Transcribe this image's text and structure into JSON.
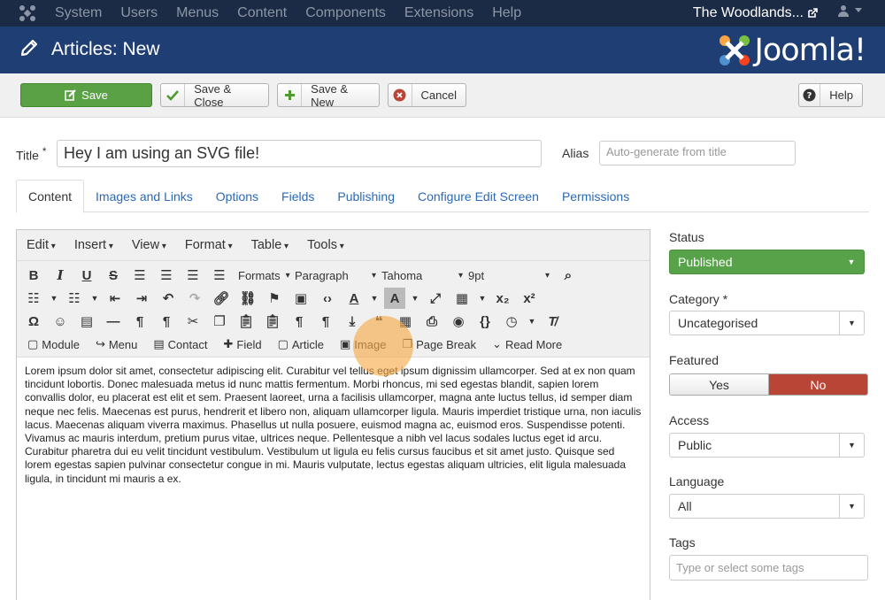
{
  "topbar": {
    "menu": [
      "System",
      "Users",
      "Menus",
      "Content",
      "Components",
      "Extensions",
      "Help"
    ],
    "site_name": "The Woodlands...",
    "icons": [
      "joomla-logo-icon",
      "external-link-icon",
      "user-icon",
      "caret-down-icon"
    ]
  },
  "header": {
    "title": "Articles: New",
    "brand": "Joomla!"
  },
  "toolbar": {
    "save": "Save",
    "save_close": "Save & Close",
    "save_new": "Save & New",
    "cancel": "Cancel",
    "help": "Help"
  },
  "form": {
    "title_label": "Title",
    "title_required": "*",
    "title_value": "Hey I am using an SVG file!",
    "alias_label": "Alias",
    "alias_placeholder": "Auto-generate from title"
  },
  "tabs": [
    "Content",
    "Images and Links",
    "Options",
    "Fields",
    "Publishing",
    "Configure Edit Screen",
    "Permissions"
  ],
  "editor": {
    "menus": [
      "Edit",
      "Insert",
      "View",
      "Format",
      "Table",
      "Tools"
    ],
    "formats": "Formats",
    "block": "Paragraph",
    "font": "Tahoma",
    "size": "9pt",
    "buttons": [
      "Module",
      "Menu",
      "Contact",
      "Field",
      "Article",
      "Image",
      "Page Break",
      "Read More"
    ],
    "body": "Lorem ipsum dolor sit amet, consectetur adipiscing elit. Curabitur vel tellus eget ipsum dignissim ullamcorper. Sed at ex non quam tincidunt lobortis. Donec malesuada metus id nunc mattis fermentum. Morbi rhoncus, mi sed egestas blandit, sapien lorem convallis dolor, eu placerat est elit et sem. Praesent laoreet, urna a facilisis ullamcorper, magna ante luctus tellus, id semper diam neque nec felis. Maecenas est purus, hendrerit et libero non, aliquam ullamcorper ligula. Mauris imperdiet tristique urna, non iaculis lacus. Maecenas aliquam viverra maximus. Phasellus ut nulla posuere, euismod magna ac, euismod eros. Suspendisse potenti. Vivamus ac mauris interdum, pretium purus vitae, ultrices neque. Pellentesque a nibh vel lacus sodales luctus eget id arcu. Curabitur pharetra dui eu velit tincidunt vestibulum. Vestibulum ut ligula eu felis cursus faucibus et sit amet justo. Quisque sed lorem egestas sapien pulvinar consectetur congue in mi. Mauris vulputate, lectus egestas aliquam ultricies, elit ligula malesuada ligula, in tincidunt mi mauris a ex."
  },
  "sidebar": {
    "status_label": "Status",
    "status_value": "Published",
    "category_label": "Category",
    "category_required": "*",
    "category_value": "Uncategorised",
    "featured_label": "Featured",
    "featured_yes": "Yes",
    "featured_no": "No",
    "access_label": "Access",
    "access_value": "Public",
    "language_label": "Language",
    "language_value": "All",
    "tags_label": "Tags",
    "tags_placeholder": "Type or select some tags"
  },
  "colors": {
    "topbar": "#1b2b45",
    "header": "#1f3e74",
    "save_green": "#5aa045",
    "no_red": "#b94537",
    "link_blue": "#2a69b8",
    "highlight": "#f6aa46"
  }
}
